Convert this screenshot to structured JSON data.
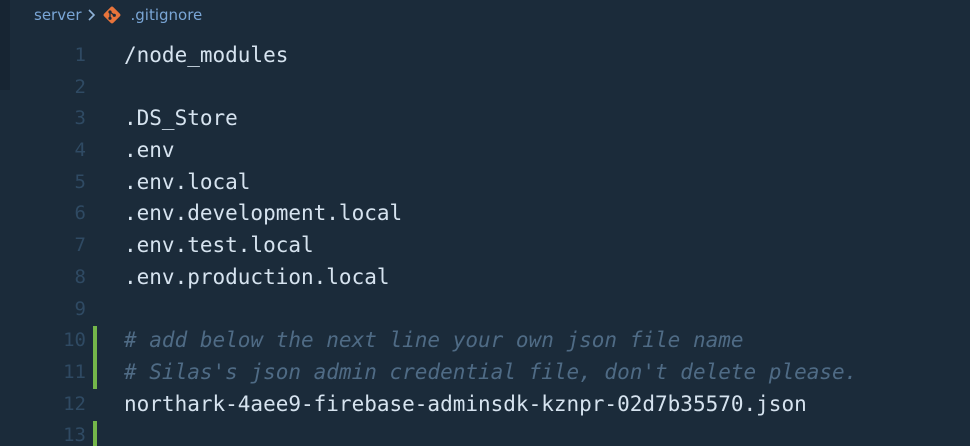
{
  "breadcrumb": {
    "folder": "server",
    "file": ".gitignore",
    "file_icon": "git-icon",
    "separator_icon": "chevron-right-icon"
  },
  "colors": {
    "background": "#1b2b3a",
    "line_number": "#2f4a63",
    "text": "#d6e3ef",
    "comment": "#4f6b85",
    "breadcrumb": "#7aa6d6",
    "git_icon": "#e8743b",
    "git_added": "#74b64a"
  },
  "lines": [
    {
      "num": "1",
      "text": "/node_modules"
    },
    {
      "num": "2",
      "text": ""
    },
    {
      "num": "3",
      "text": ".DS_Store"
    },
    {
      "num": "4",
      "text": ".env"
    },
    {
      "num": "5",
      "text": ".env.local"
    },
    {
      "num": "6",
      "text": ".env.development.local"
    },
    {
      "num": "7",
      "text": ".env.test.local"
    },
    {
      "num": "8",
      "text": ".env.production.local"
    },
    {
      "num": "9",
      "text": ""
    },
    {
      "num": "10",
      "text": "# add below the next line your own json file name"
    },
    {
      "num": "11",
      "text": "# Silas's json admin credential file, don't delete please."
    },
    {
      "num": "12",
      "text": "northark-4aee9-firebase-adminsdk-kznpr-02d7b35570.json"
    },
    {
      "num": "13",
      "text": ""
    }
  ]
}
